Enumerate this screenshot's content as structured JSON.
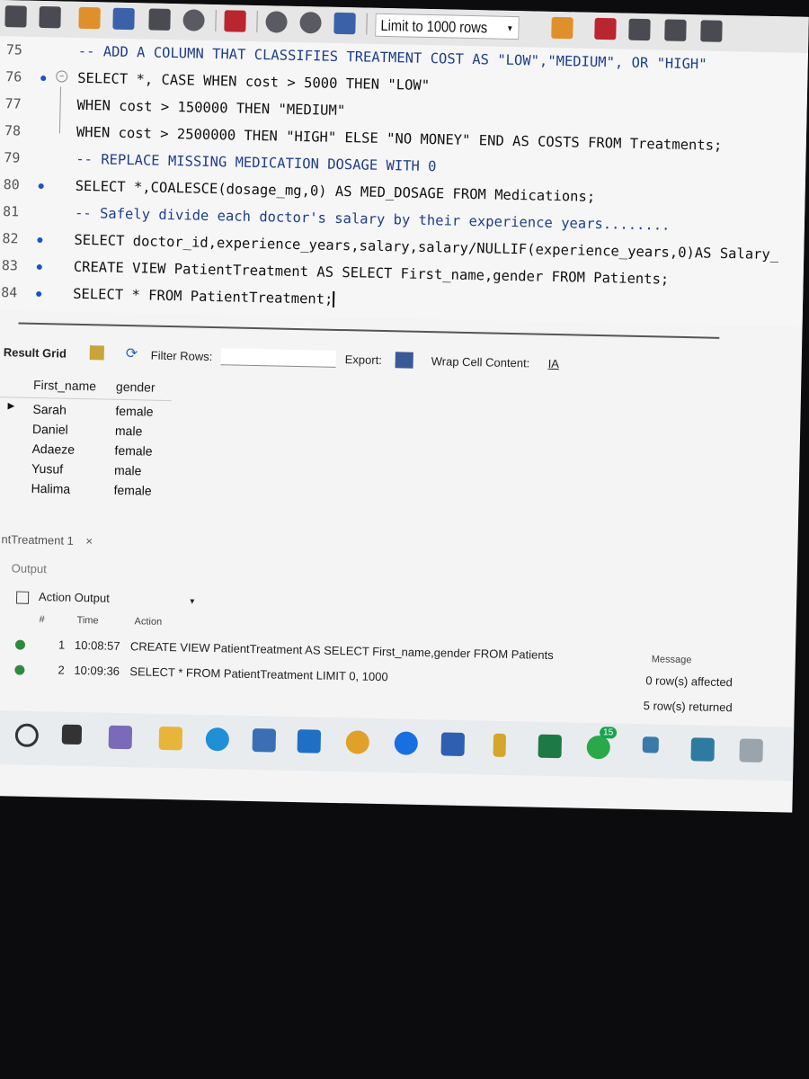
{
  "toolbar": {
    "limit_label": "Limit to 1000 rows",
    "icons": [
      "save-icon",
      "execute-icon",
      "execute-current-icon",
      "explain-icon",
      "stop-icon",
      "toggle-icon",
      "commit-icon",
      "rollback-icon",
      "autocommit-icon",
      "beautify-icon",
      "find-icon",
      "invisible-icon",
      "wrap-icon"
    ]
  },
  "editor": {
    "lines": [
      {
        "num": "75",
        "text": "-- ADD A COLUMN THAT CLASSIFIES TREATMENT COST AS \"LOW\",\"MEDIUM\", OR \"HIGH\""
      },
      {
        "num": "76",
        "text": "SELECT *, CASE WHEN cost > 5000 THEN \"LOW\""
      },
      {
        "num": "77",
        "text": "WHEN cost > 150000 THEN \"MEDIUM\""
      },
      {
        "num": "78",
        "text": "WHEN cost > 2500000 THEN \"HIGH\" ELSE \"NO MONEY\" END AS COSTS FROM Treatments;"
      },
      {
        "num": "79",
        "text": "-- REPLACE MISSING MEDICATION DOSAGE WITH 0"
      },
      {
        "num": "80",
        "text": "SELECT *,COALESCE(dosage_mg,0) AS MED_DOSAGE FROM Medications;"
      },
      {
        "num": "81",
        "text": "-- Safely divide each doctor's salary by their experience years........"
      },
      {
        "num": "82",
        "text": "SELECT doctor_id,experience_years,salary,salary/NULLIF(experience_years,0)AS Salary_"
      },
      {
        "num": "83",
        "text": "CREATE VIEW PatientTreatment AS SELECT First_name,gender FROM Patients;"
      },
      {
        "num": "84",
        "text": "SELECT * FROM PatientTreatment;"
      }
    ]
  },
  "result_bar": {
    "tab": "Result Grid",
    "filter_label": "Filter Rows:",
    "export_label": "Export:",
    "wrap_label": "Wrap Cell Content:",
    "wrap_icon_text": "IA"
  },
  "grid": {
    "columns": [
      "First_name",
      "gender"
    ],
    "rows": [
      [
        "Sarah",
        "female"
      ],
      [
        "Daniel",
        "male"
      ],
      [
        "Adaeze",
        "female"
      ],
      [
        "Yusuf",
        "male"
      ],
      [
        "Halima",
        "female"
      ]
    ]
  },
  "output": {
    "tab_label": "ntTreatment 1",
    "tab_close": "×",
    "section_label": "Output",
    "selector_label": "Action Output",
    "columns": {
      "num": "#",
      "time": "Time",
      "action": "Action",
      "message": "Message"
    },
    "rows": [
      {
        "num": "1",
        "time": "10:08:57",
        "action": "CREATE VIEW PatientTreatment AS SELECT First_name,gender FROM Patients",
        "message": "0 row(s) affected"
      },
      {
        "num": "2",
        "time": "10:09:36",
        "action": "SELECT * FROM PatientTreatment LIMIT 0, 1000",
        "message": "5 row(s) returned"
      }
    ]
  },
  "taskbar": {
    "icons": [
      "start-icon",
      "search-icon",
      "task-view-icon",
      "widgets-icon",
      "file-explorer-icon",
      "edge-icon",
      "store-icon",
      "outlook-icon",
      "chrome-icon",
      "facebook-icon",
      "word-icon",
      "files-icon",
      "excel-icon",
      "whatsapp-icon",
      "mysql-icon",
      "network-icon"
    ],
    "whatsapp_badge": "15"
  }
}
